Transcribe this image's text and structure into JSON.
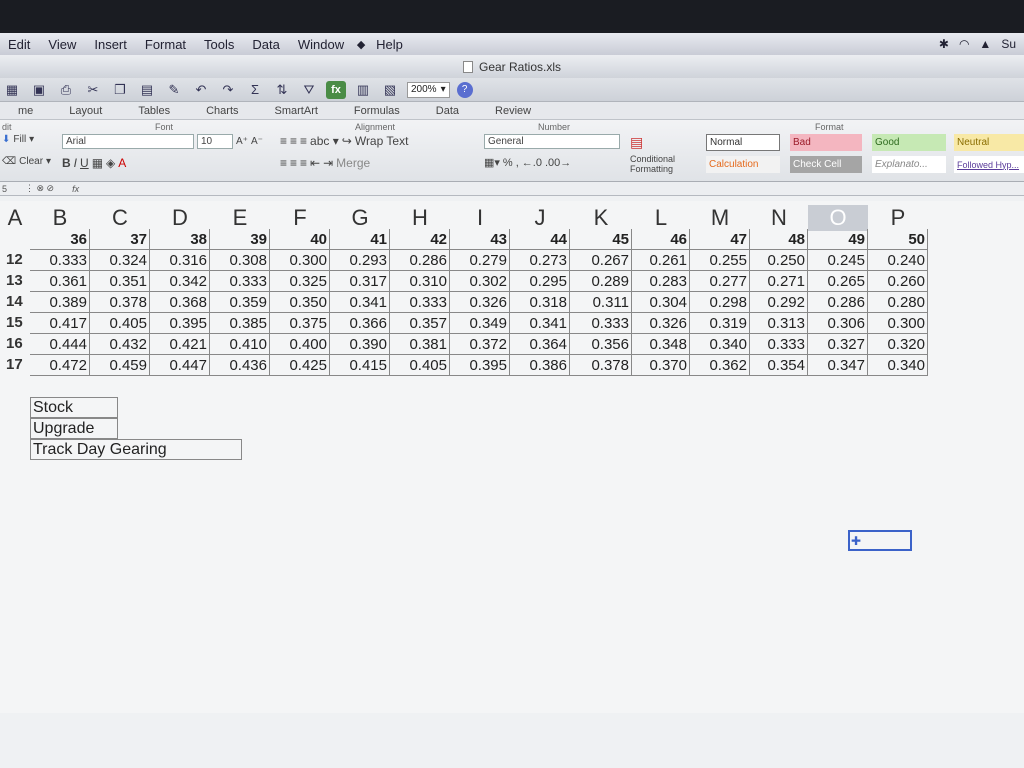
{
  "menubar": {
    "items": [
      "Edit",
      "View",
      "Insert",
      "Format",
      "Tools",
      "Data",
      "Window",
      "Help"
    ],
    "status_right": "Su"
  },
  "window": {
    "title": "Gear Ratios.xls"
  },
  "toolbar": {
    "zoom": "200%"
  },
  "ribbon": {
    "tabs": [
      "me",
      "Layout",
      "Tables",
      "Charts",
      "SmartArt",
      "Formulas",
      "Data",
      "Review"
    ],
    "groups": {
      "font": "Font",
      "alignment": "Alignment",
      "number": "Number",
      "format": "Format",
      "edit": "dit"
    },
    "fill_label": "Fill",
    "clear_label": "Clear",
    "font_name": "Arial",
    "font_size": "10",
    "wrap_text": "Wrap Text",
    "merge": "Merge",
    "number_format": "General",
    "conditional_formatting": "Conditional Formatting",
    "styles": [
      {
        "label": "Normal",
        "bg": "#ffffff",
        "fg": "#333333"
      },
      {
        "label": "Bad",
        "bg": "#f4b6c0",
        "fg": "#9c1c2a"
      },
      {
        "label": "Good",
        "bg": "#c6e9b4",
        "fg": "#2e6b1f"
      },
      {
        "label": "Neutral",
        "bg": "#f8e9a6",
        "fg": "#8a6d00"
      },
      {
        "label": "Calculation",
        "bg": "#f2f2f2",
        "fg": "#e56a1c"
      },
      {
        "label": "Check Cell",
        "bg": "#a5a5a5",
        "fg": "#ffffff"
      },
      {
        "label": "Explanato...",
        "bg": "#ffffff",
        "fg": "#888888"
      },
      {
        "label": "Followed Hyp...",
        "bg": "#ffffff",
        "fg": "#5a3c9a"
      }
    ]
  },
  "formula_bar": {
    "cell_ref": "5",
    "fx": "fx"
  },
  "sheet": {
    "columns": [
      "A",
      "B",
      "C",
      "D",
      "E",
      "F",
      "G",
      "H",
      "I",
      "J",
      "K",
      "L",
      "M",
      "N",
      "O",
      "P"
    ],
    "selected_column": "O",
    "header_row": [
      "36",
      "37",
      "38",
      "39",
      "40",
      "41",
      "42",
      "43",
      "44",
      "45",
      "46",
      "47",
      "48",
      "49",
      "50"
    ],
    "rows": [
      {
        "label": "12",
        "values": [
          "0.333",
          "0.324",
          "0.316",
          "0.308",
          "0.300",
          "0.293",
          "0.286",
          "0.279",
          "0.273",
          "0.267",
          "0.261",
          "0.255",
          "0.250",
          "0.245",
          "0.240"
        ]
      },
      {
        "label": "13",
        "values": [
          "0.361",
          "0.351",
          "0.342",
          "0.333",
          "0.325",
          "0.317",
          "0.310",
          "0.302",
          "0.295",
          "0.289",
          "0.283",
          "0.277",
          "0.271",
          "0.265",
          "0.260"
        ]
      },
      {
        "label": "14",
        "values": [
          "0.389",
          "0.378",
          "0.368",
          "0.359",
          "0.350",
          "0.341",
          "0.333",
          "0.326",
          "0.318",
          "0.311",
          "0.304",
          "0.298",
          "0.292",
          "0.286",
          "0.280"
        ]
      },
      {
        "label": "15",
        "values": [
          "0.417",
          "0.405",
          "0.395",
          "0.385",
          "0.375",
          "0.366",
          "0.357",
          "0.349",
          "0.341",
          "0.333",
          "0.326",
          "0.319",
          "0.313",
          "0.306",
          "0.300"
        ]
      },
      {
        "label": "16",
        "values": [
          "0.444",
          "0.432",
          "0.421",
          "0.410",
          "0.400",
          "0.390",
          "0.381",
          "0.372",
          "0.364",
          "0.356",
          "0.348",
          "0.340",
          "0.333",
          "0.327",
          "0.320"
        ]
      },
      {
        "label": "17",
        "values": [
          "0.472",
          "0.459",
          "0.447",
          "0.436",
          "0.425",
          "0.415",
          "0.405",
          "0.395",
          "0.386",
          "0.378",
          "0.370",
          "0.362",
          "0.354",
          "0.347",
          "0.340"
        ]
      }
    ],
    "legend": [
      "Stock",
      "Upgrade",
      "Track Day Gearing"
    ]
  }
}
